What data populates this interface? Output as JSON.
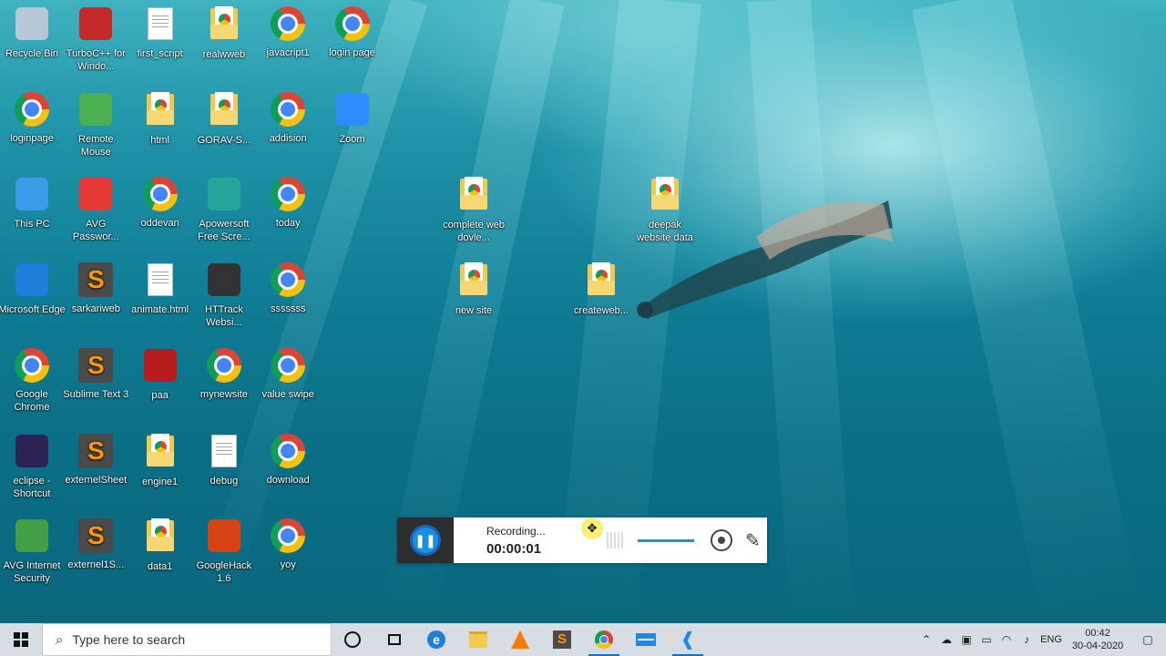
{
  "desktop": {
    "icons": [
      {
        "label": "Recycle Bin",
        "kind": "recycle-bin-icon"
      },
      {
        "label": "TurboC++ for Windo...",
        "kind": "turboc-icon"
      },
      {
        "label": "first_script",
        "kind": "python-file-icon"
      },
      {
        "label": "realwweb",
        "kind": "folder-icon"
      },
      {
        "label": "javacript1",
        "kind": "chrome-icon"
      },
      {
        "label": "login page",
        "kind": "chrome-icon"
      },
      {
        "label": "loginpage",
        "kind": "chrome-icon"
      },
      {
        "label": "Remote Mouse",
        "kind": "remote-mouse-icon"
      },
      {
        "label": "html",
        "kind": "folder-icon"
      },
      {
        "label": "GORAV-S...",
        "kind": "folder-icon"
      },
      {
        "label": "addision",
        "kind": "chrome-icon"
      },
      {
        "label": "Zoom",
        "kind": "zoom-icon"
      },
      {
        "label": "This PC",
        "kind": "this-pc-icon"
      },
      {
        "label": "AVG Passwor...",
        "kind": "avg-password-icon"
      },
      {
        "label": "oddevan",
        "kind": "chrome-icon"
      },
      {
        "label": "Apowersoft Free Scre...",
        "kind": "apowersoft-icon"
      },
      {
        "label": "today",
        "kind": "chrome-icon"
      },
      {
        "label": "complete web dovle...",
        "kind": "folder-icon"
      },
      {
        "label": "deepak website data",
        "kind": "folder-icon"
      },
      {
        "label": "Microsoft Edge",
        "kind": "edge-icon"
      },
      {
        "label": "sarkariweb",
        "kind": "sublime-icon"
      },
      {
        "label": "animate.html",
        "kind": "html-file-icon"
      },
      {
        "label": "HTTrack Websi...",
        "kind": "httrack-icon"
      },
      {
        "label": "sssssss",
        "kind": "chrome-icon"
      },
      {
        "label": "new site",
        "kind": "folder-icon"
      },
      {
        "label": "createweb...",
        "kind": "folder-icon"
      },
      {
        "label": "Google Chrome",
        "kind": "chrome-icon"
      },
      {
        "label": "Sublime Text 3",
        "kind": "sublime-icon"
      },
      {
        "label": "paa",
        "kind": "book-icon"
      },
      {
        "label": "mynewsite",
        "kind": "chrome-icon"
      },
      {
        "label": "value swipe",
        "kind": "chrome-icon"
      },
      {
        "label": "eclipse - Shortcut",
        "kind": "eclipse-icon"
      },
      {
        "label": "externelSheet",
        "kind": "sublime-icon"
      },
      {
        "label": "engine1",
        "kind": "folder-icon"
      },
      {
        "label": "debug",
        "kind": "text-file-icon"
      },
      {
        "label": "download",
        "kind": "chrome-icon"
      },
      {
        "label": "AVG Internet Security",
        "kind": "avg-icon"
      },
      {
        "label": "externel1S...",
        "kind": "sublime-icon"
      },
      {
        "label": "data1",
        "kind": "folder-icon"
      },
      {
        "label": "GoogleHack 1.6",
        "kind": "googlehack-icon"
      },
      {
        "label": "yoy",
        "kind": "chrome-icon"
      }
    ]
  },
  "recorder": {
    "status": "Recording...",
    "time": "00:00:01",
    "pause_icon": "pause-icon",
    "webcam_icon": "webcam-icon",
    "pen_icon": "pen-icon",
    "move_icon": "move-icon"
  },
  "taskbar": {
    "search_placeholder": "Type here to search",
    "apps": [
      "cortana-icon",
      "task-view-icon",
      "edge-icon",
      "file-explorer-icon",
      "vlc-icon",
      "sublime-icon",
      "chrome-icon",
      "mail-icon",
      "vscode-icon"
    ],
    "tray": {
      "language": "ENG",
      "time": "00:42",
      "date": "30-04-2020"
    }
  },
  "colors": {
    "accent": "#0078d7",
    "recorder_button": "#1d8fe1"
  }
}
